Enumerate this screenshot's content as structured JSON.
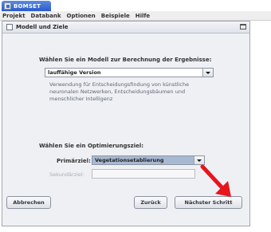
{
  "window": {
    "title": "BOMSET"
  },
  "menu": [
    "Projekt",
    "Databank",
    "Optionen",
    "Beispiele",
    "Hilfe"
  ],
  "frame": {
    "title": "Modell und Ziele"
  },
  "model": {
    "heading": "Wählen Sie ein Modell zur Berechnung der Ergebnisse:",
    "selected": "lauffähige Version",
    "description": "Verwendung für Entscheidungsfindung von künstliche neuronalen Netzwerken, Entscheidungsbäumen und menschlicher Intelligenz"
  },
  "goal": {
    "heading": "Wählen Sie ein Optimierungsziel:",
    "primary_label": "Primärziel:",
    "primary_value": "Vegetationsetablierung",
    "secondary_label": "Sekundärziel:",
    "secondary_value": ""
  },
  "buttons": {
    "cancel": "Abbrechen",
    "back": "Zurück",
    "next": "Nächster Schritt"
  },
  "colors": {
    "annotation_arrow": "#e8141c"
  }
}
